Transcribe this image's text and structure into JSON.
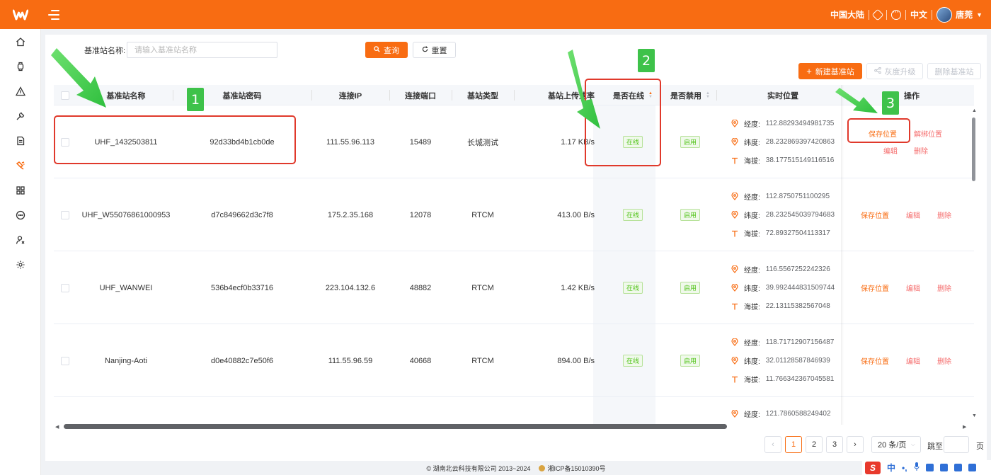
{
  "header": {
    "region": "中国大陆",
    "language": "中文",
    "user_name": "唐莞"
  },
  "filter": {
    "label": "基准站名称:",
    "placeholder": "请输入基准站名称",
    "search_label": "查询",
    "reset_label": "重置"
  },
  "toolbar": {
    "create_label": "新建基准站",
    "gray_upgrade_label": "灰度升级",
    "delete_label": "删除基准站"
  },
  "columns": {
    "name": "基准站名称",
    "password": "基准站密码",
    "ip": "连接IP",
    "port": "连接端口",
    "type": "基站类型",
    "upload_rate": "基站上传速率",
    "online": "是否在线",
    "disabled": "是否禁用",
    "location": "实时位置",
    "actions": "操作"
  },
  "location_labels": {
    "longitude": "经度:",
    "latitude": "纬度:",
    "altitude": "海拔:"
  },
  "rows": [
    {
      "name": "UHF_1432503811",
      "password": "92d33bd4b1cb0de",
      "ip": "111.55.96.113",
      "port": "15489",
      "type": "长城测试",
      "upload_rate": "1.17 KB/s",
      "online": "在线",
      "enabled": "启用",
      "longitude": "112.88293494981735",
      "latitude": "28.232869397420863",
      "altitude": "38.177515149116516",
      "actions": [
        "保存位置",
        "解绑位置",
        "编辑",
        "删除"
      ]
    },
    {
      "name": "UHF_W55076861000953",
      "password": "d7c849662d3c7f8",
      "ip": "175.2.35.168",
      "port": "12078",
      "type": "RTCM",
      "upload_rate": "413.00 B/s",
      "online": "在线",
      "enabled": "启用",
      "longitude": "112.8750751100295",
      "latitude": "28.232545039794683",
      "altitude": "72.89327504113317",
      "actions": [
        "保存位置",
        "编辑",
        "删除"
      ]
    },
    {
      "name": "UHF_WANWEI",
      "password": "536b4ecf0b33716",
      "ip": "223.104.132.6",
      "port": "48882",
      "type": "RTCM",
      "upload_rate": "1.42 KB/s",
      "online": "在线",
      "enabled": "启用",
      "longitude": "116.5567252242326",
      "latitude": "39.992444831509744",
      "altitude": "22.13115382567048",
      "actions": [
        "保存位置",
        "编辑",
        "删除"
      ]
    },
    {
      "name": "Nanjing-Aoti",
      "password": "d0e40882c7e50f6",
      "ip": "111.55.96.59",
      "port": "40668",
      "type": "RTCM",
      "upload_rate": "894.00 B/s",
      "online": "在线",
      "enabled": "启用",
      "longitude": "118.71712907156487",
      "latitude": "32.01128587846939",
      "altitude": "11.766342367045581",
      "actions": [
        "保存位置",
        "编辑",
        "删除"
      ]
    },
    {
      "longitude": "121.7860588249402"
    }
  ],
  "pagination": {
    "pages": [
      "1",
      "2",
      "3"
    ],
    "current": "1",
    "page_size": "20 条/页",
    "jump_label": "跳至",
    "page_unit": "页"
  },
  "footer": {
    "copyright": "© 湖南北云科技有限公司 2013~2024",
    "icp": "湘ICP备15010390号"
  },
  "ime": {
    "mode": "中",
    "punct": "•,"
  },
  "annotations": [
    "1",
    "2",
    "3"
  ],
  "colors": {
    "brand": "#f86c12",
    "danger_link": "#f56c6c",
    "success": "#52c41a",
    "annotation_red": "#e0392b",
    "annotation_green": "#3ec24a"
  }
}
